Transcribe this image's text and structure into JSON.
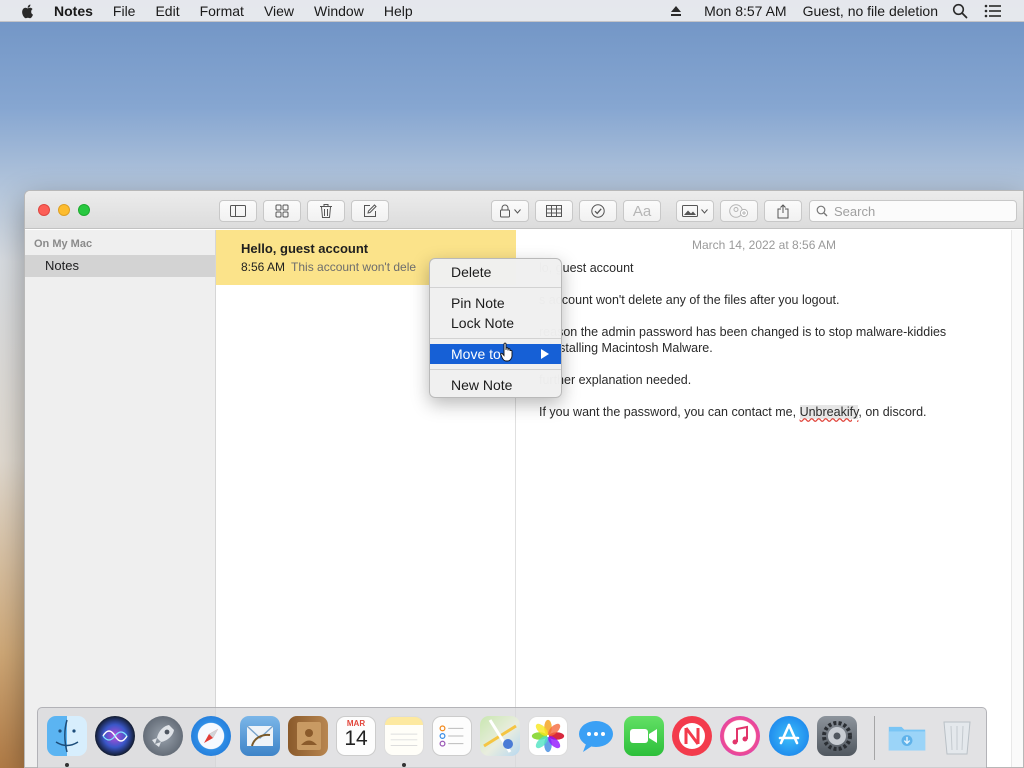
{
  "menubar": {
    "app_name": "Notes",
    "menus": [
      "File",
      "Edit",
      "Format",
      "View",
      "Window",
      "Help"
    ],
    "clock": "Mon 8:57 AM",
    "user": "Guest, no file deletion"
  },
  "sidebar": {
    "section_title": "On My Mac",
    "folders": [
      {
        "label": "Notes",
        "selected": true
      }
    ]
  },
  "toolbar": {
    "search_placeholder": "Search",
    "format_label": "Aa"
  },
  "note_list": [
    {
      "title": "Hello, guest account",
      "time": "8:56 AM",
      "snippet": "This account won't dele",
      "selected": true
    }
  ],
  "editor": {
    "date": "March 14, 2022 at 8:56 AM",
    "lines": [
      "lo, guest account",
      "s account won't delete any of the files after you logout.",
      "reason the admin password has been changed is to stop malware-kiddies",
      "n installing Macintosh Malware.",
      "further explanation needed.",
      "If you want the password, you can contact me,",
      "Unbreakify",
      ", on discord."
    ]
  },
  "context_menu": {
    "items": [
      {
        "label": "Delete"
      },
      {
        "label": "Pin Note"
      },
      {
        "label": "Lock Note"
      },
      {
        "label": "Move to",
        "highlighted": true,
        "submenu": true
      },
      {
        "label": "New Note"
      }
    ]
  },
  "dock": {
    "apps": [
      "Finder",
      "Siri",
      "Launchpad",
      "Safari",
      "Mail",
      "Contacts",
      "Calendar",
      "Notes",
      "Reminders",
      "Maps",
      "Photos",
      "Messages",
      "FaceTime",
      "News",
      "iTunes",
      "App Store",
      "System Preferences",
      "Downloads",
      "Trash"
    ],
    "calendar_month": "MAR",
    "calendar_day": "14"
  },
  "colors": {
    "note_selected": "#fbe38a",
    "menu_highlight": "#1660d6",
    "sidebar_selected": "#d3d3d3"
  }
}
